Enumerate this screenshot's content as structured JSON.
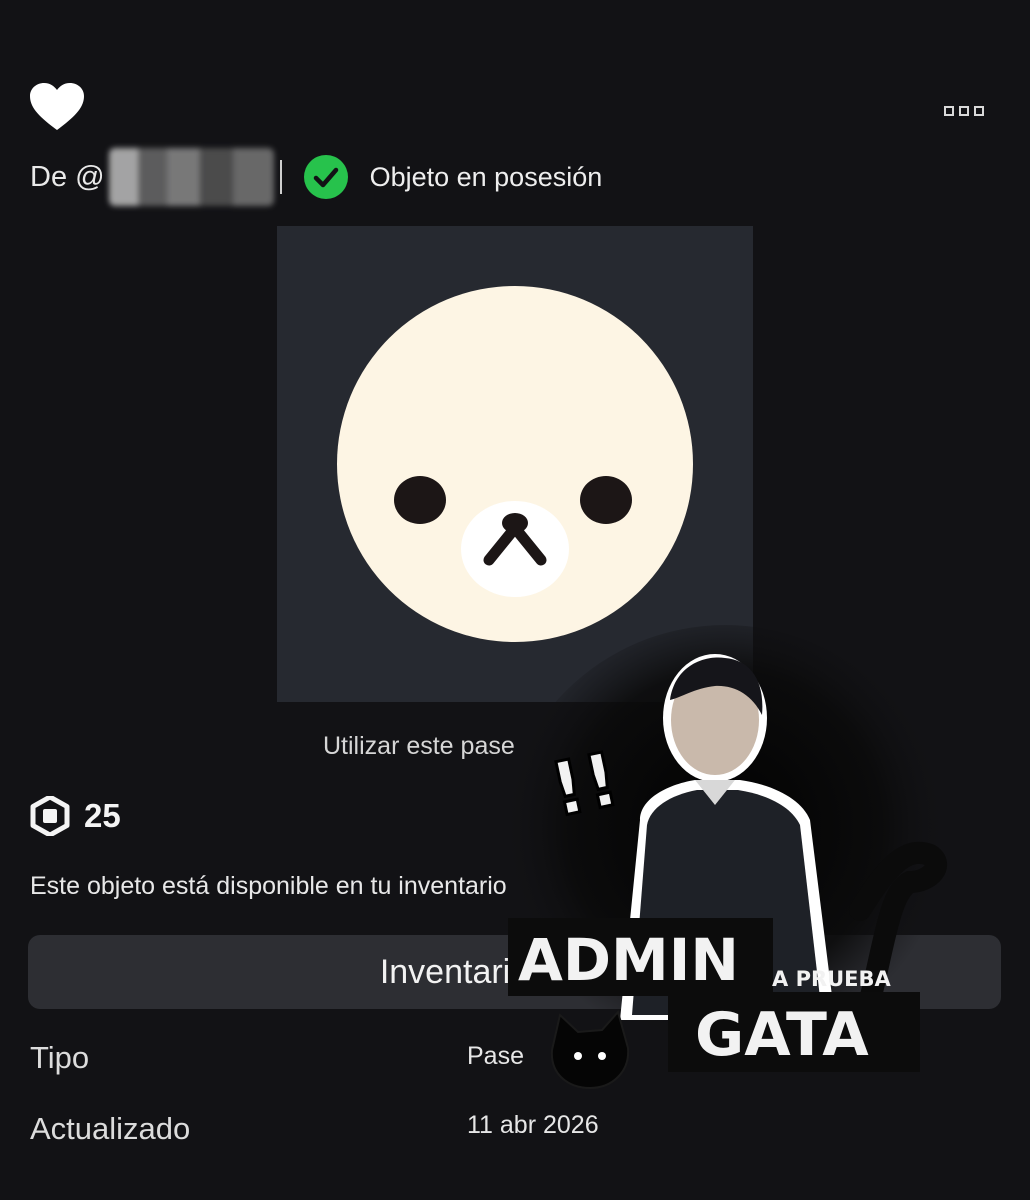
{
  "header": {
    "favorite_icon": "heart-icon",
    "more_icon": "more-options-icon"
  },
  "creator": {
    "prefix": "De @",
    "name_hidden": true
  },
  "ownership": {
    "icon": "check-circle-icon",
    "label": "Objeto en posesión",
    "color": "#27c24c"
  },
  "item": {
    "thumbnail_icon": "bear-face-image",
    "use_text": "Utilizar este pase",
    "price_icon": "robux-icon",
    "price": "25",
    "availability": "Este objeto está disponible en tu inventario",
    "inventory_button": "Inventario"
  },
  "details": {
    "type_label": "Tipo",
    "type_value": "Pase",
    "updated_label": "Actualizado",
    "updated_value": "11 abr 2026"
  },
  "sticker": {
    "title": "ADMIN",
    "small": "A PRUEBA",
    "name": "GATA",
    "exclaim": "!!"
  },
  "colors": {
    "background": "#121215",
    "button": "#2d2e33",
    "thumbnail_bg": "#262930",
    "bear_face": "#fdf5e4"
  }
}
